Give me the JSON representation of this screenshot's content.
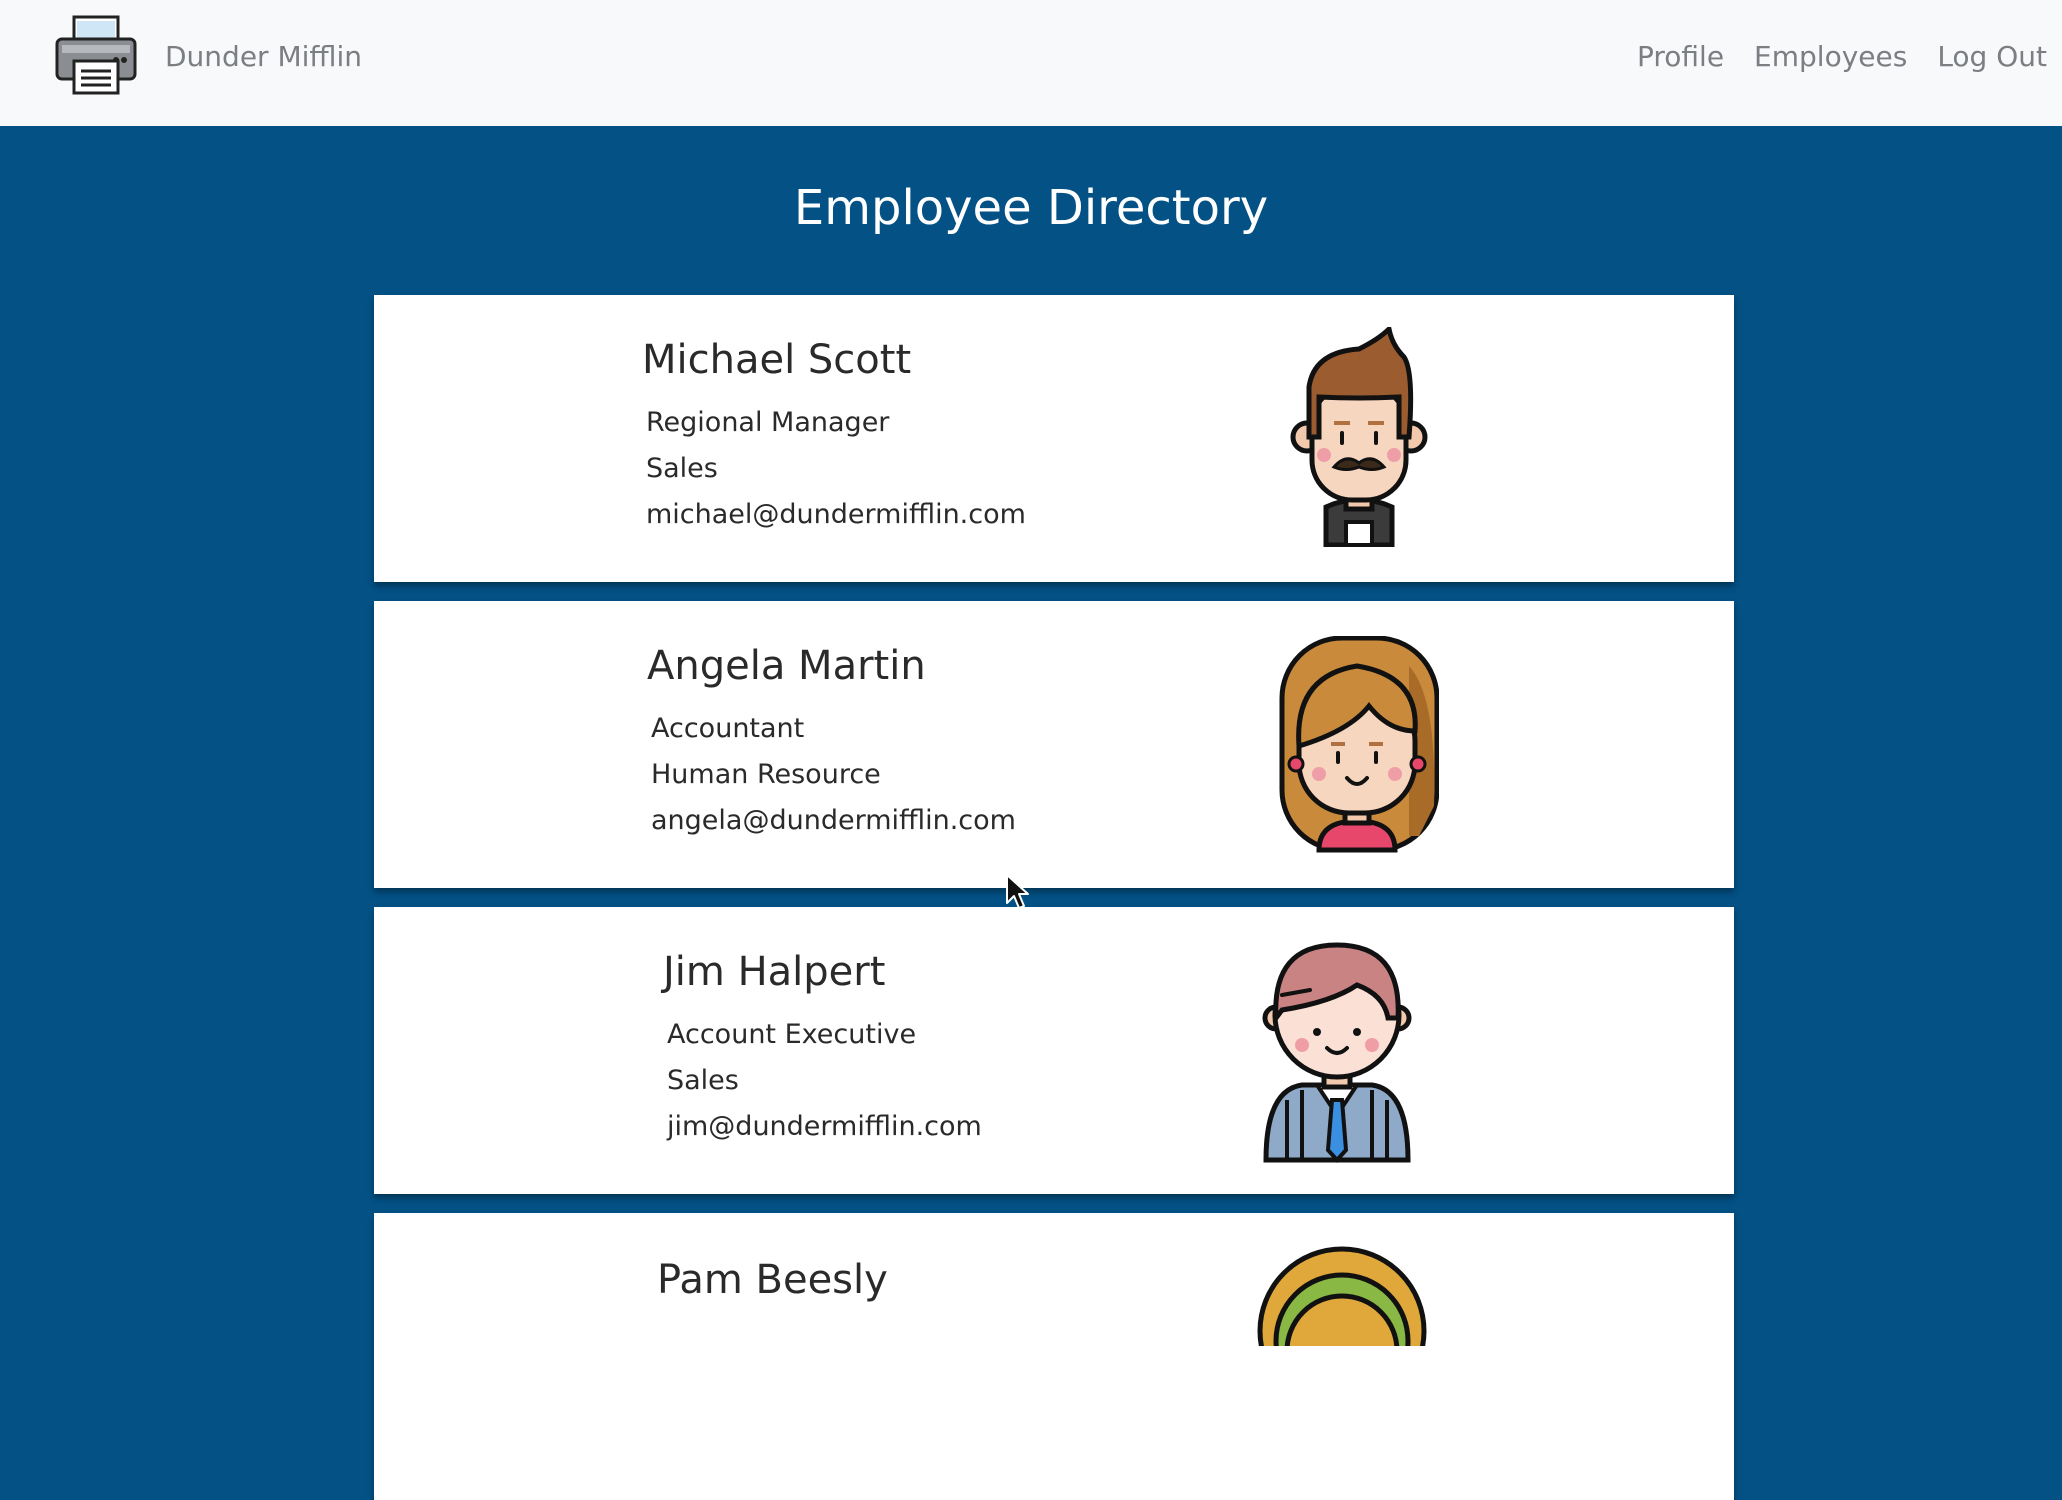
{
  "navbar": {
    "brand_name": "Dunder Mifflin",
    "links": [
      "Profile",
      "Employees",
      "Log Out"
    ]
  },
  "page": {
    "title": "Employee Directory"
  },
  "employees": [
    {
      "name": "Michael Scott",
      "role": "Regional Manager",
      "department": "Sales",
      "email": "michael@dundermifflin.com"
    },
    {
      "name": "Angela Martin",
      "role": "Accountant",
      "department": "Human Resource",
      "email": "angela@dundermifflin.com"
    },
    {
      "name": "Jim Halpert",
      "role": "Account Executive",
      "department": "Sales",
      "email": "jim@dundermifflin.com"
    },
    {
      "name": "Pam Beesly"
    }
  ],
  "icons": {
    "logo": "printer-icon",
    "cursor": "mouse-pointer-icon"
  }
}
